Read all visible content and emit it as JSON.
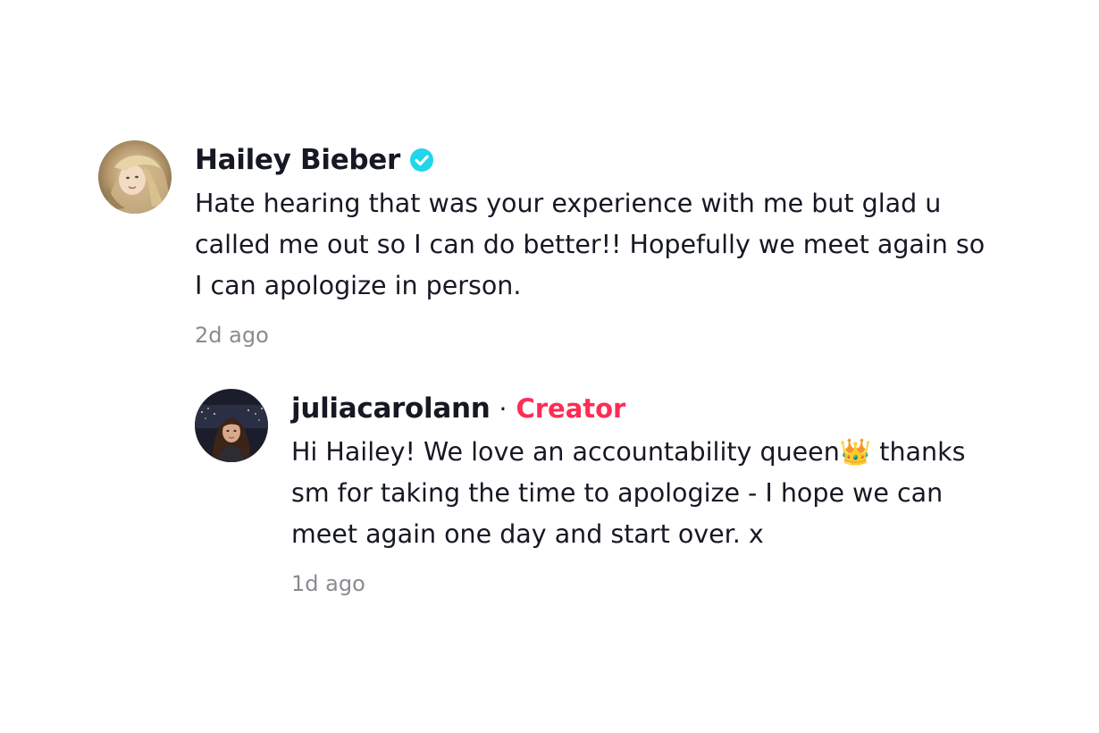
{
  "comments": [
    {
      "username": "Hailey Bieber",
      "verified": true,
      "text": "Hate hearing that was your experience with me but glad u\ncalled me out so I can do better!! Hopefully we meet again so\nI can apologize in person.",
      "timestamp": "2d ago",
      "avatar_icon": "blonde-woman-avatar"
    },
    {
      "username": "juliacarolann",
      "separator": "·",
      "badge": "Creator",
      "text": "Hi Hailey! We love an accountability queen👑 thanks\nsm for taking the time to apologize - I hope we can\nmeet again one day and start over. x",
      "timestamp": "1d ago",
      "avatar_icon": "brunette-woman-night-city-avatar"
    }
  ],
  "colors": {
    "verified_badge": "#20d5ec",
    "creator_badge": "#fe2c55",
    "timestamp": "#8a8b91",
    "text": "#161823"
  }
}
